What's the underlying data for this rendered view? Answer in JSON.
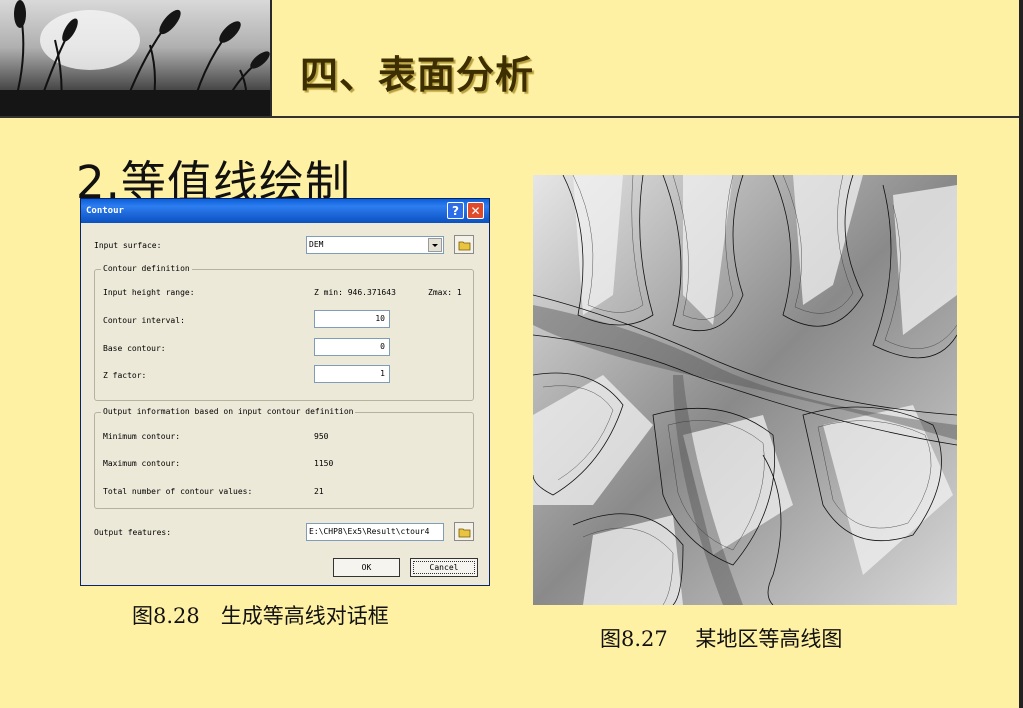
{
  "slide": {
    "title": "四、表面分析",
    "section_title": "2.等值线绘制",
    "caption_left": "图8.28　生成等高线对话框",
    "caption_right": "图8.27　 某地区等高线图"
  },
  "dialog": {
    "title": "Contour",
    "help_label": "?",
    "close_label": "✕",
    "input_surface_label": "Input surface:",
    "input_surface_value": "DEM",
    "group1_legend": "Contour definition",
    "height_range_label": "Input height range:",
    "zmin_text": "Z min: 946.371643",
    "zmax_text": "Zmax: 1",
    "interval_label": "Contour interval:",
    "interval_value": "10",
    "base_label": "Base contour:",
    "base_value": "0",
    "zfactor_label": "Z factor:",
    "zfactor_value": "1",
    "group2_legend": "Output information based on input contour definition",
    "min_contour_label": "Minimum contour:",
    "min_contour_value": "950",
    "max_contour_label": "Maximum contour:",
    "max_contour_value": "1150",
    "total_label": "Total number of contour values:",
    "total_value": "21",
    "output_label": "Output features:",
    "output_value": "E:\\CHP8\\Ex5\\Result\\ctour4",
    "ok_label": "OK",
    "cancel_label": "Cancel"
  },
  "icons": {
    "folder": "open-folder-icon",
    "dropdown": "dropdown-arrow-icon"
  },
  "colors": {
    "slide_background": "#fff1a3",
    "title_text": "#3d2e00",
    "dialog_titlebar": "#0a5fd8",
    "dialog_body": "#ece9d8",
    "close_button": "#e04a2a"
  }
}
